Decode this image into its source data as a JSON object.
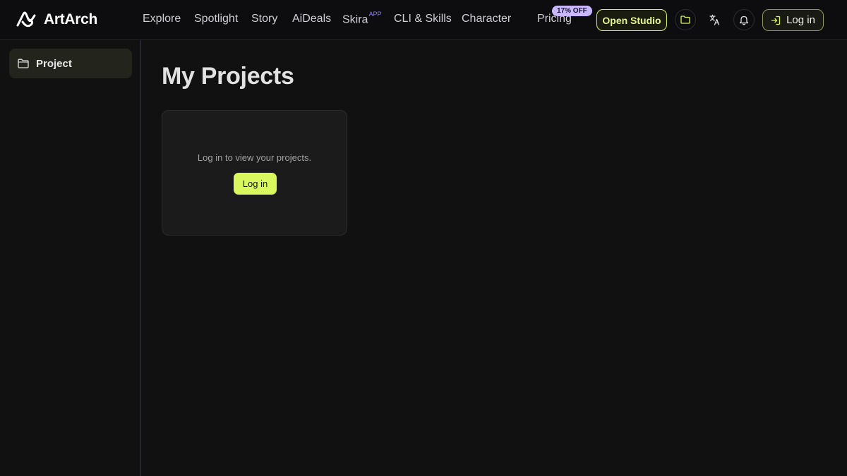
{
  "app": {
    "name": "ArtArch"
  },
  "nav": {
    "explore": "Explore",
    "spotlight": "Spotlight",
    "story": "Story",
    "aideals": "AiDeals",
    "skira": "Skira",
    "skira_sup": "APP",
    "cli": "CLI & Skills",
    "character": "Character",
    "pricing": "Pricing",
    "pricing_badge": "17% OFF"
  },
  "header_actions": {
    "open_studio": "Open Studio",
    "login": "Log in",
    "icons": [
      "folder-icon",
      "translate-icon",
      "bell-icon",
      "login-icon"
    ]
  },
  "sidebar": {
    "items": [
      {
        "label": "Project",
        "icon": "folder-icon"
      }
    ]
  },
  "main": {
    "title": "My Projects",
    "card": {
      "message": "Log in to view your projects.",
      "button": "Log in"
    }
  },
  "colors": {
    "accent": "#d9f85d",
    "badge": "#c9b8ff",
    "background": "#111111"
  }
}
